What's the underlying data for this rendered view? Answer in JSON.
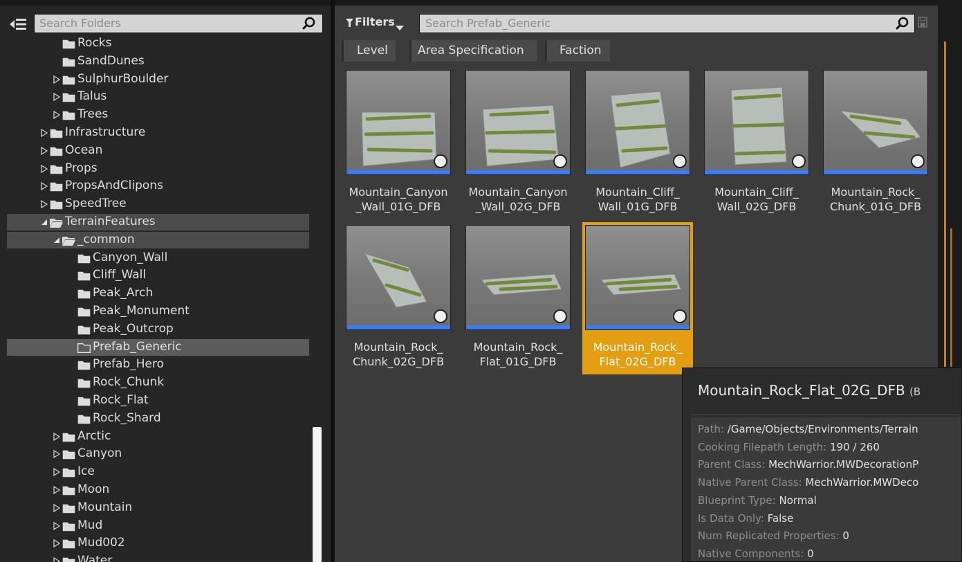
{
  "folder_panel": {
    "search_placeholder": "Search Folders",
    "tree_items": [
      {
        "label": "Rocks",
        "indent": 3,
        "arrow": "none"
      },
      {
        "label": "SandDunes",
        "indent": 3,
        "arrow": "none"
      },
      {
        "label": "SulphurBoulder",
        "indent": 3,
        "arrow": "collapsed"
      },
      {
        "label": "Talus",
        "indent": 3,
        "arrow": "collapsed"
      },
      {
        "label": "Trees",
        "indent": 3,
        "arrow": "collapsed"
      },
      {
        "label": "Infrastructure",
        "indent": 2,
        "arrow": "collapsed"
      },
      {
        "label": "Ocean",
        "indent": 2,
        "arrow": "collapsed"
      },
      {
        "label": "Props",
        "indent": 2,
        "arrow": "collapsed"
      },
      {
        "label": "PropsAndClipons",
        "indent": 2,
        "arrow": "collapsed"
      },
      {
        "label": "SpeedTree",
        "indent": 2,
        "arrow": "collapsed"
      },
      {
        "label": "TerrainFeatures",
        "indent": 2,
        "arrow": "expanded",
        "state": "active-path"
      },
      {
        "label": "_common",
        "indent": 3,
        "arrow": "expanded",
        "state": "active-path"
      },
      {
        "label": "Canyon_Wall",
        "indent": 4,
        "arrow": "none"
      },
      {
        "label": "Cliff_Wall",
        "indent": 4,
        "arrow": "none"
      },
      {
        "label": "Peak_Arch",
        "indent": 4,
        "arrow": "none"
      },
      {
        "label": "Peak_Monument",
        "indent": 4,
        "arrow": "none"
      },
      {
        "label": "Peak_Outcrop",
        "indent": 4,
        "arrow": "none"
      },
      {
        "label": "Prefab_Generic",
        "indent": 4,
        "arrow": "none",
        "state": "selected"
      },
      {
        "label": "Prefab_Hero",
        "indent": 4,
        "arrow": "none"
      },
      {
        "label": "Rock_Chunk",
        "indent": 4,
        "arrow": "none"
      },
      {
        "label": "Rock_Flat",
        "indent": 4,
        "arrow": "none"
      },
      {
        "label": "Rock_Shard",
        "indent": 4,
        "arrow": "none"
      },
      {
        "label": "Arctic",
        "indent": 3,
        "arrow": "collapsed"
      },
      {
        "label": "Canyon",
        "indent": 3,
        "arrow": "collapsed"
      },
      {
        "label": "Ice",
        "indent": 3,
        "arrow": "collapsed"
      },
      {
        "label": "Moon",
        "indent": 3,
        "arrow": "collapsed"
      },
      {
        "label": "Mountain",
        "indent": 3,
        "arrow": "collapsed"
      },
      {
        "label": "Mud",
        "indent": 3,
        "arrow": "collapsed"
      },
      {
        "label": "Mud002",
        "indent": 3,
        "arrow": "collapsed"
      },
      {
        "label": "Water",
        "indent": 3,
        "arrow": "collapsed"
      }
    ]
  },
  "content_panel": {
    "filters_label": "Filters",
    "search_placeholder": "Search Prefab_Generic",
    "filter_chips": [
      "Level",
      "Area Specification",
      "Faction"
    ],
    "assets": [
      {
        "line1": "Mountain_Canyon",
        "line2": "_Wall_01G_DFB",
        "shape": "canyon1"
      },
      {
        "line1": "Mountain_Canyon",
        "line2": "_Wall_02G_DFB",
        "shape": "canyon2"
      },
      {
        "line1": "Mountain_Cliff_",
        "line2": "Wall_01G_DFB",
        "shape": "cliff1"
      },
      {
        "line1": "Mountain_Cliff_",
        "line2": "Wall_02G_DFB",
        "shape": "cliff2"
      },
      {
        "line1": "Mountain_Rock_",
        "line2": "Chunk_01G_DFB",
        "shape": "chunk1"
      },
      {
        "line1": "Mountain_Rock_",
        "line2": "Chunk_02G_DFB",
        "shape": "chunk2"
      },
      {
        "line1": "Mountain_Rock_",
        "line2": "Flat_01G_DFB",
        "shape": "flat1"
      },
      {
        "line1": "Mountain_Rock_",
        "line2": "Flat_02G_DFB",
        "shape": "flat2",
        "selected": true
      }
    ]
  },
  "tooltip": {
    "title": "Mountain_Rock_Flat_02G_DFB",
    "title_suffix": "(B",
    "properties": [
      {
        "key": "Path:",
        "value": "/Game/Objects/Environments/Terrain"
      },
      {
        "key": "Cooking Filepath Length:",
        "value": "190 / 260"
      },
      {
        "key": "Parent Class:",
        "value": "MechWarrior.MWDecorationP"
      },
      {
        "key": "Native Parent Class:",
        "value": "MechWarrior.MWDeco"
      },
      {
        "key": "Blueprint Type:",
        "value": "Normal"
      },
      {
        "key": "Is Data Only:",
        "value": "False"
      },
      {
        "key": "Num Replicated Properties:",
        "value": "0"
      },
      {
        "key": "Native Components:",
        "value": "0"
      }
    ]
  },
  "colors": {
    "selection_orange": "#e49e12",
    "thumb_bar_blue": "#3d7cf0",
    "rock_green": "#6f8a3a"
  }
}
